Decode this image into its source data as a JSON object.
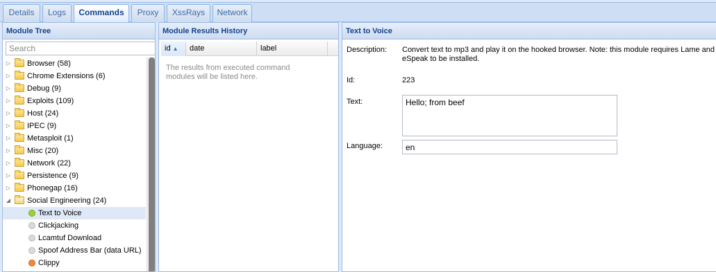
{
  "tabs": [
    {
      "label": "Details",
      "active": false
    },
    {
      "label": "Logs",
      "active": false
    },
    {
      "label": "Commands",
      "active": true
    },
    {
      "label": "Proxy",
      "active": false
    },
    {
      "label": "XssRays",
      "active": false
    },
    {
      "label": "Network",
      "active": false
    }
  ],
  "module_tree": {
    "title": "Module Tree",
    "search_placeholder": "Search",
    "folders": [
      {
        "label": "Browser (58)",
        "expanded": false
      },
      {
        "label": "Chrome Extensions (6)",
        "expanded": false
      },
      {
        "label": "Debug (9)",
        "expanded": false
      },
      {
        "label": "Exploits (109)",
        "expanded": false
      },
      {
        "label": "Host (24)",
        "expanded": false
      },
      {
        "label": "IPEC (9)",
        "expanded": false
      },
      {
        "label": "Metasploit (1)",
        "expanded": false
      },
      {
        "label": "Misc (20)",
        "expanded": false
      },
      {
        "label": "Network (22)",
        "expanded": false
      },
      {
        "label": "Persistence (9)",
        "expanded": false
      },
      {
        "label": "Phonegap (16)",
        "expanded": false
      },
      {
        "label": "Social Engineering (24)",
        "expanded": true
      }
    ],
    "modules": [
      {
        "label": "Text to Voice",
        "status": "green",
        "selected": true
      },
      {
        "label": "Clickjacking",
        "status": "grey",
        "selected": false
      },
      {
        "label": "Lcamtuf Download",
        "status": "grey",
        "selected": false
      },
      {
        "label": "Spoof Address Bar (data URL)",
        "status": "grey",
        "selected": false
      },
      {
        "label": "Clippy",
        "status": "orange",
        "selected": false
      }
    ],
    "status_colors": {
      "green": "#9bd23b",
      "grey": "#d9d9d9",
      "orange": "#f08a36"
    }
  },
  "results": {
    "title": "Module Results History",
    "columns": [
      "id",
      "date",
      "label"
    ],
    "sorted_column": "id",
    "empty_message": "The results from executed command modules will be listed here."
  },
  "module_detail": {
    "title": "Text to Voice",
    "description_label": "Description:",
    "description": "Convert text to mp3 and play it on the hooked browser. Note: this module requires Lame and eSpeak to be installed.",
    "id_label": "Id:",
    "id": "223",
    "text_label": "Text:",
    "text_value": "Hello; from beef",
    "language_label": "Language:",
    "language_value": "en"
  },
  "colors": {
    "header_text": "#15428b",
    "border": "#99bbe8",
    "selected_row": "#dfe8f6"
  }
}
